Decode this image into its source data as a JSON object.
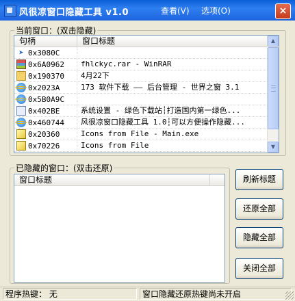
{
  "window": {
    "title": "风很凉窗口隐藏工具 v1.0",
    "menu_view": "查看(V)",
    "menu_options": "选项(O)",
    "close_symbol": "×"
  },
  "current_group": {
    "legend": "当前窗口：(双击隐藏)",
    "columns": [
      "句柄",
      "窗口标题"
    ],
    "rows": [
      {
        "icon": "arrow-icon",
        "handle": "0x3080C",
        "title": ""
      },
      {
        "icon": "winrar-icon",
        "handle": "0x6A0962",
        "title": "fhlckyc.rar - WinRAR"
      },
      {
        "icon": "folder-icon",
        "handle": "0x190370",
        "title": "4月22下"
      },
      {
        "icon": "ie-icon",
        "handle": "0x2023A",
        "title": "173 软件下载 —— 后台管理 - 世界之窗 3.1"
      },
      {
        "icon": "ie-icon",
        "handle": "0x5B0A9C",
        "title": ""
      },
      {
        "icon": "window-icon",
        "handle": "0x402BE",
        "title": "系统设置 - 绿色下载站┆打造国内第一绿色..."
      },
      {
        "icon": "ie-icon",
        "handle": "0x460744",
        "title": "风很凉窗口隐藏工具 1.0┆可以方便操作隐藏..."
      },
      {
        "icon": "pen-icon",
        "handle": "0x20360",
        "title": "Icons from File - Main.exe"
      },
      {
        "icon": "pen-icon",
        "handle": "0x70226",
        "title": "Icons from File"
      }
    ],
    "scroll_up": "▲",
    "scroll_down": "▼"
  },
  "hidden_group": {
    "legend": "已隐藏的窗口：(双击还原)",
    "columns": [
      "窗口标题"
    ]
  },
  "buttons": {
    "refresh": "刷新标题",
    "restore_all": "还原全部",
    "hide_all": "隐藏全部",
    "close_all": "关闭全部"
  },
  "status": {
    "hotkey": "程序热键：  无",
    "restore_hotkey": "窗口隐藏还原热键尚未开启"
  }
}
